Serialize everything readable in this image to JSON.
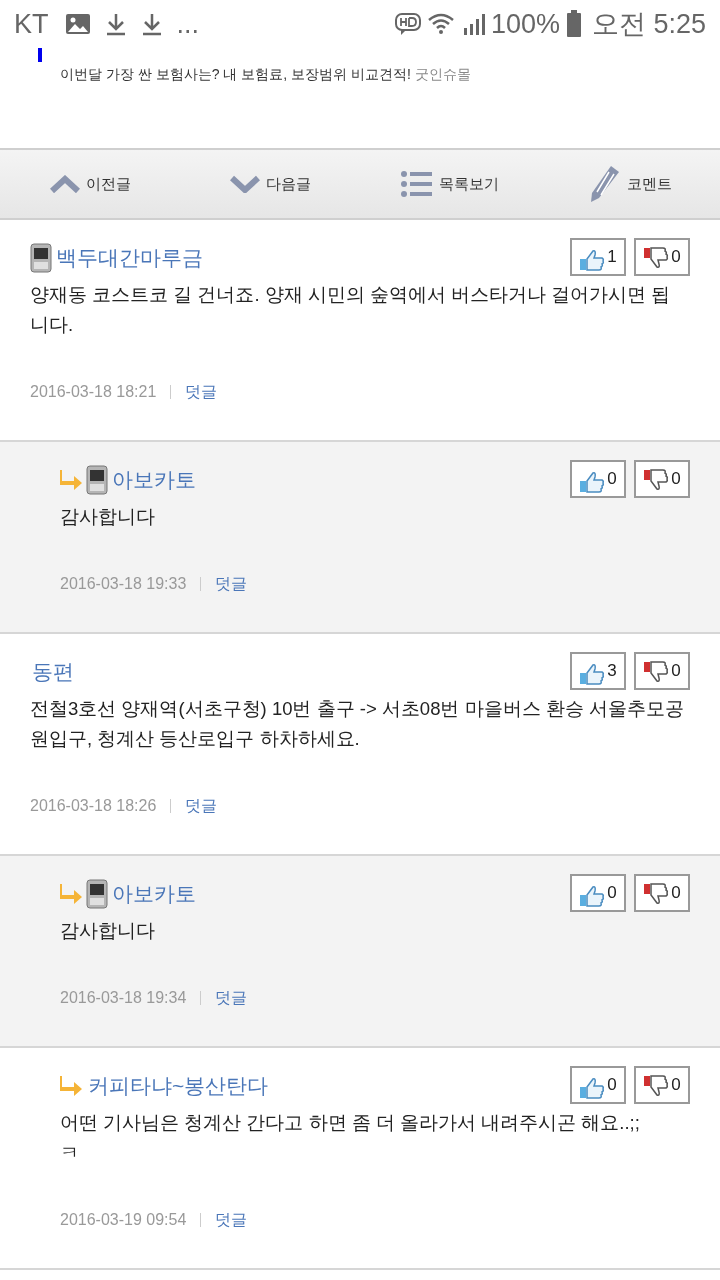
{
  "status_bar": {
    "carrier": "KT",
    "more": "...",
    "battery": "100%",
    "time": "오전 5:25"
  },
  "ad": {
    "text": "이번달 가장 싼 보험사는? 내 보험료, 보장범위 비교견적!",
    "source": "굿인슈몰"
  },
  "nav": [
    {
      "kind": "prev",
      "label": "이전글"
    },
    {
      "kind": "next",
      "label": "다음글"
    },
    {
      "kind": "list",
      "label": "목록보기"
    },
    {
      "kind": "comment",
      "label": "코멘트"
    }
  ],
  "comments": [
    {
      "kind": "top",
      "shaded": false,
      "mobile": true,
      "author": "백두대간마루금",
      "likes": "1",
      "dislikes": "0",
      "text": "양재동 코스트코 길 건너죠. 양재 시민의 숲역에서 버스타거나 걸어가시면 됩니다.",
      "date": "2016-03-18 18:21",
      "reply": "덧글"
    },
    {
      "kind": "reply",
      "shaded": true,
      "mobile": true,
      "author": "아보카토",
      "likes": "0",
      "dislikes": "0",
      "text": "감사합니다",
      "date": "2016-03-18 19:33",
      "reply": "덧글"
    },
    {
      "kind": "top",
      "shaded": false,
      "mobile": false,
      "author": "동편",
      "likes": "3",
      "dislikes": "0",
      "text": "전철3호선 양재역(서초구청) 10번 출구 -> 서초08번 마을버스 환승 서울추모공원입구, 청계산 등산로입구 하차하세요.",
      "date": "2016-03-18 18:26",
      "reply": "덧글"
    },
    {
      "kind": "reply",
      "shaded": true,
      "mobile": true,
      "author": "아보카토",
      "likes": "0",
      "dislikes": "0",
      "text": "감사합니다",
      "date": "2016-03-18 19:34",
      "reply": "덧글"
    },
    {
      "kind": "reply",
      "shaded": false,
      "mobile": false,
      "author": "커피타냐~봉산탄다",
      "likes": "0",
      "dislikes": "0",
      "text": "어떤 기사님은 청계산 간다고 하면 좀 더 올라가서 내려주시곤 해요..;;\nㅋ",
      "date": "2016-03-19 09:54",
      "reply": "덧글"
    }
  ]
}
